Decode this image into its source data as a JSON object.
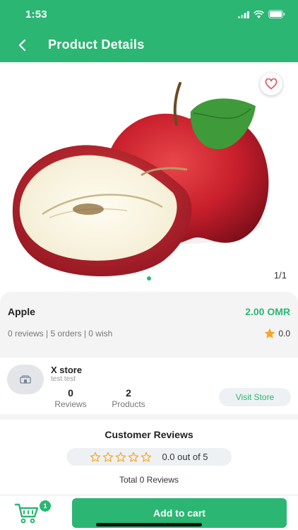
{
  "status_bar": {
    "time": "1:53"
  },
  "header": {
    "title": "Product Details",
    "back_icon": "chevron-left-icon"
  },
  "gallery": {
    "counter": "1/1",
    "favorite_icon": "heart-icon",
    "image_subject": "apple"
  },
  "product": {
    "name": "Apple",
    "price": "2.00 OMR",
    "stats": "0 reviews | 5 orders | 0 wish",
    "rating": "0.0"
  },
  "store": {
    "name": "X store",
    "subtitle": "test test",
    "reviews_count": "0",
    "reviews_label": "Reviews",
    "products_count": "2",
    "products_label": "Products",
    "visit_label": "Visit Store"
  },
  "reviews": {
    "title": "Customer Reviews",
    "score": "0.0 out of 5",
    "stars_filled": 0,
    "stars_total": 5,
    "total": "Total 0 Reviews"
  },
  "bottom_bar": {
    "cart_badge": "1",
    "add_to_cart_label": "Add to cart"
  },
  "colors": {
    "brand": "#2bb673",
    "star": "#f5a623"
  }
}
